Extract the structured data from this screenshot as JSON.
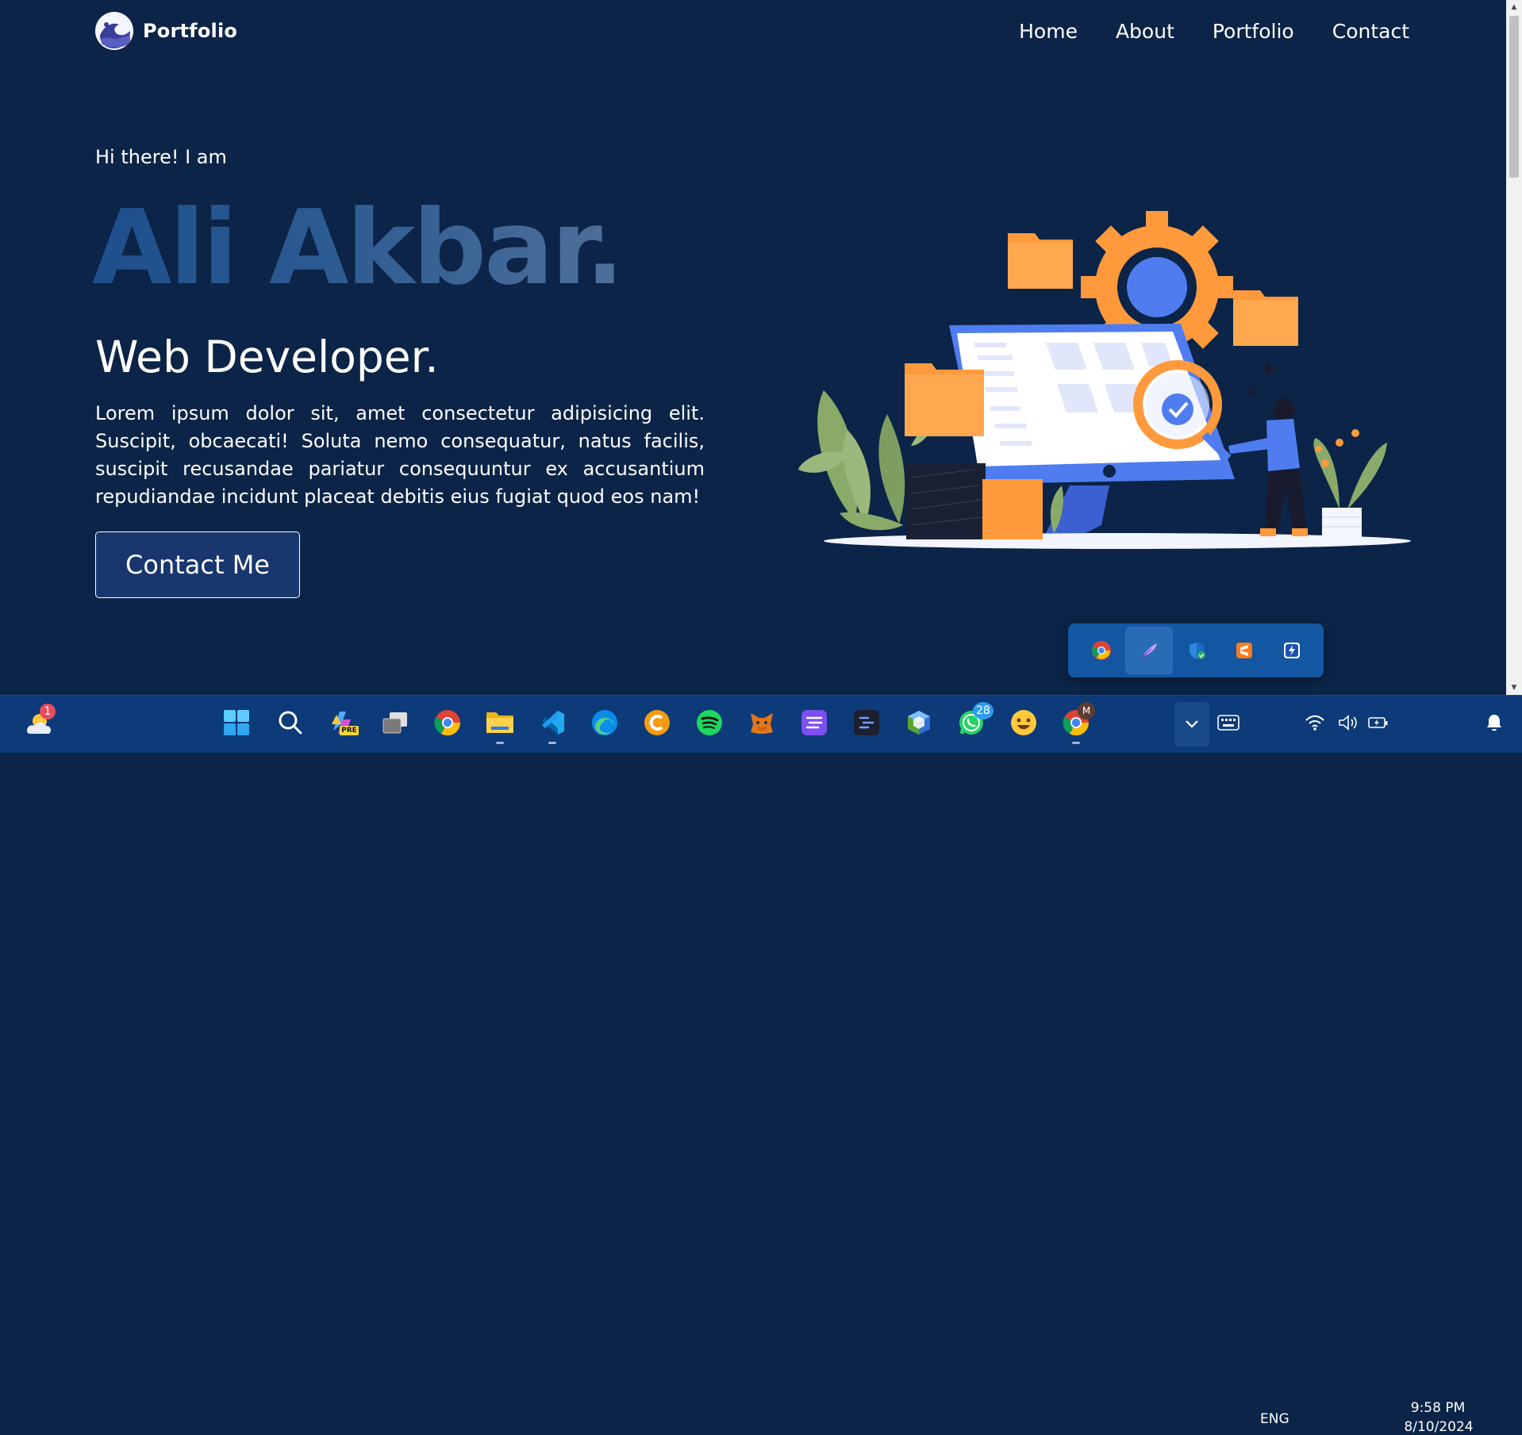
{
  "nav": {
    "brand": "Portfolio",
    "links": [
      "Home",
      "About",
      "Portfolio",
      "Contact"
    ]
  },
  "hero": {
    "greeting": "Hi there! I am",
    "name": "Ali Akbar.",
    "role": "Web Developer.",
    "bio": "Lorem ipsum dolor sit, amet consectetur adipisicing elit. Suscipit, obcaecati! Soluta nemo consequatur, natus facilis, suscipit recusandae pariatur consequuntur ex accusantium repudiandae incidunt placeat debitis eius fugiat quod eos nam!",
    "cta": "Contact Me"
  },
  "colors": {
    "background": "#0b2447",
    "button": "#19376d",
    "accent_orange": "#ff9a3c",
    "accent_blue": "#4f7df0",
    "taskbar": "#0d3a78"
  },
  "tray_popup": {
    "icons": [
      "chrome-icon",
      "feather-icon",
      "defender-icon",
      "sublime-icon",
      "flash-icon"
    ]
  },
  "taskbar": {
    "weather_badge": "1",
    "apps": [
      "start-icon",
      "search-icon",
      "copilot-icon",
      "task-view-icon",
      "chrome-icon",
      "file-explorer-icon",
      "vscode-icon",
      "edge-icon",
      "ccleaner-icon",
      "spotify-icon",
      "metamask-icon",
      "linear-icon",
      "terminal-icon",
      "virtualbox-icon",
      "whatsapp-icon",
      "emoji-app-icon",
      "chrome-profile-icon"
    ],
    "copilot_badge": "PRE",
    "whatsapp_badge": "28",
    "chrome_profile_badge": "M",
    "language": "ENG",
    "time": "9:58 PM",
    "date": "8/10/2024"
  }
}
